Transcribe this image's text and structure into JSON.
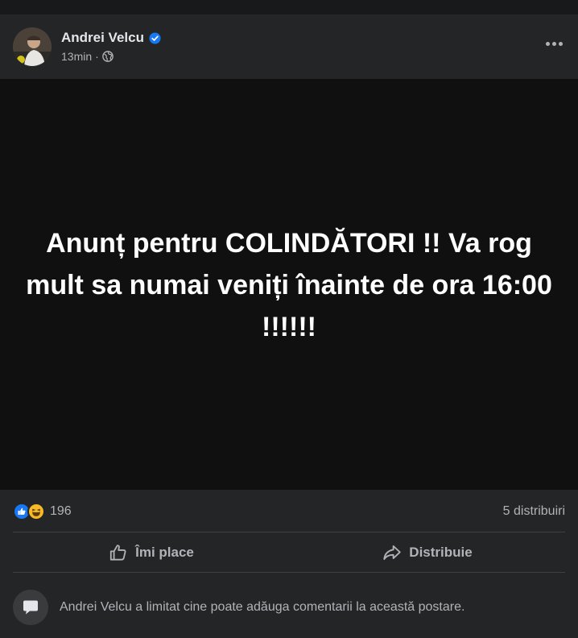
{
  "post": {
    "author": "Andrei Velcu",
    "verified": true,
    "timestamp": "13min",
    "separator": "·",
    "audience_icon": "globe-icon",
    "text": "Anunț pentru COLINDĂTORI !! Va rog mult sa numai veniți înainte de ora 16:00 !!!!!!",
    "background": "#101011"
  },
  "stats": {
    "reaction_icons": [
      "like-icon",
      "haha-icon"
    ],
    "reaction_count": "196",
    "shares": "5 distribuiri"
  },
  "actions": {
    "like_label": "Îmi place",
    "share_label": "Distribuie"
  },
  "comments_notice": "Andrei Velcu a limitat cine poate adăuga comentarii la această postare.",
  "colors": {
    "card": "#242526",
    "accent_blue": "#1877f2",
    "text_secondary": "#b0b3b8"
  }
}
